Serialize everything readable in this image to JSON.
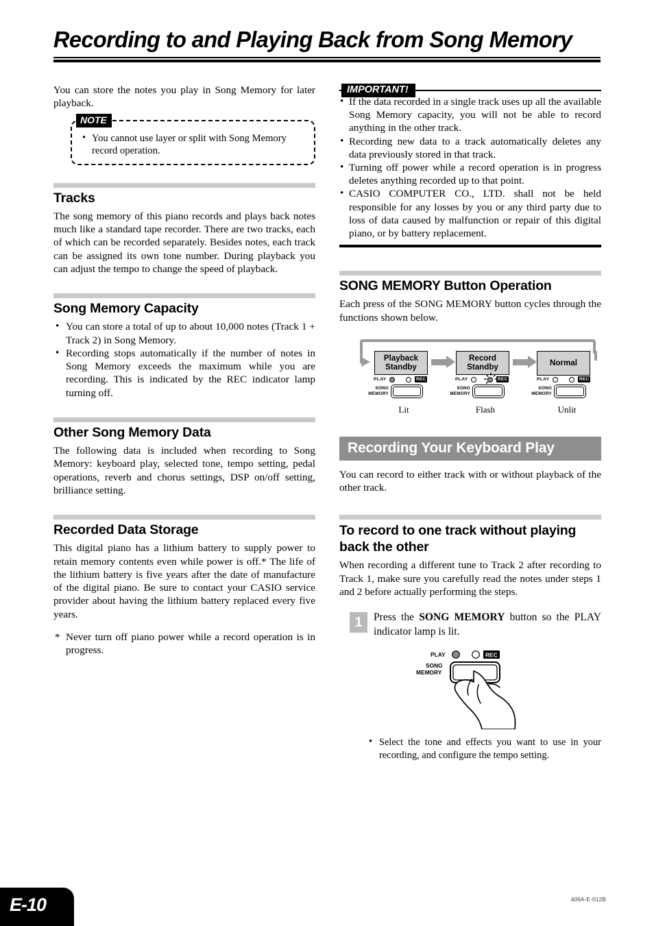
{
  "page": {
    "title": "Recording to and Playing Back from Song Memory",
    "footer_page_label": "E-10",
    "footer_code": "406A-E-012B"
  },
  "left_column": {
    "intro": "You can store the notes you play in Song Memory for later playback.",
    "note": {
      "badge": "NOTE",
      "items": [
        "You cannot use layer or split with Song Memory record operation."
      ]
    },
    "sections": [
      {
        "heading": "Tracks",
        "paragraph": "The song memory of this piano records and plays back notes much like a standard tape recorder. There are two tracks, each of which can be recorded separately. Besides notes, each track can be assigned its own tone number. During playback you can adjust the tempo to change the speed of playback."
      },
      {
        "heading": "Song Memory Capacity",
        "bullets": [
          "You can store a total of up to about 10,000 notes (Track 1 + Track 2) in Song Memory.",
          "Recording stops automatically if the number of notes in Song Memory exceeds the maximum while you are recording. This is indicated by the REC indicator lamp turning off."
        ]
      },
      {
        "heading": "Other Song Memory Data",
        "paragraph": "The following data is included when recording to Song Memory: keyboard play, selected tone, tempo setting, pedal operations, reverb and chorus settings, DSP on/off setting, brilliance setting."
      },
      {
        "heading": "Recorded Data Storage",
        "paragraph": "This digital piano has a lithium battery to supply power to retain memory contents even while power is off.* The life of the lithium battery is five years after the date of manufacture of the digital piano. Be sure to contact your CASIO service provider about having the lithium battery replaced every five years.",
        "star_note": "Never turn off piano power while a record operation is in progress."
      }
    ]
  },
  "right_column": {
    "important": {
      "badge": "IMPORTANT!",
      "items": [
        "If the data recorded in a single track uses up all the available Song Memory capacity, you will not be able to record anything in the other track.",
        "Recording new data to a track automatically deletes any data previously stored in that track.",
        "Turning off power while a record operation is in progress deletes anything recorded up to that point.",
        "CASIO COMPUTER CO., LTD. shall not be held responsible for any losses by you or any third party due to loss of data caused by malfunction or repair of this digital piano, or by battery replacement."
      ]
    },
    "button_operation": {
      "heading": "SONG MEMORY Button Operation",
      "paragraph": "Each press of the SONG MEMORY button cycles through the functions shown below.",
      "cycle": [
        {
          "state": "Playback Standby",
          "state_line1": "Playback",
          "state_line2": "Standby",
          "play_label": "PLAY",
          "rec_label": "REC",
          "button_line1": "SONG",
          "button_line2": "MEMORY",
          "play_led": "on",
          "rec_led": "off",
          "caption": "Lit"
        },
        {
          "state": "Record Standby",
          "state_line1": "Record",
          "state_line2": "Standby",
          "play_label": "PLAY",
          "rec_label": "REC",
          "button_line1": "SONG",
          "button_line2": "MEMORY",
          "play_led": "off",
          "rec_led": "flash",
          "caption": "Flash"
        },
        {
          "state": "Normal",
          "state_line1": "Normal",
          "state_line2": "",
          "play_label": "PLAY",
          "rec_label": "REC",
          "button_line1": "SONG",
          "button_line2": "MEMORY",
          "play_led": "off",
          "rec_led": "off",
          "caption": "Unlit"
        }
      ]
    },
    "banner": "Recording Your Keyboard Play",
    "banner_paragraph": "You can record to either track with or without playback of the other track.",
    "subsection": {
      "heading_line1": "To record to one track without playing",
      "heading_line2": "back the other",
      "paragraph": "When recording a different tune to Track 2 after recording to Track 1, make sure you carefully read the notes under steps 1 and 2 before actually performing the steps."
    },
    "step1": {
      "number": "1",
      "text_before": "Press the ",
      "text_bold": "SONG MEMORY",
      "text_after": " button so the PLAY indicator lamp is lit."
    },
    "hand_figure": {
      "play_label": "PLAY",
      "rec_label": "REC",
      "button_line1": "SONG",
      "button_line2": "MEMORY"
    },
    "step1_bullets": [
      "Select the tone and effects you want to use in your recording, and configure the tempo setting."
    ]
  },
  "colors": {
    "section_bar": "#c9c9c9",
    "banner_bg": "#8e8e8e",
    "state_box_bg": "#d0d0d0",
    "arrow_gray": "#9a9a9a",
    "step_num_bg": "#b9b9b9"
  }
}
